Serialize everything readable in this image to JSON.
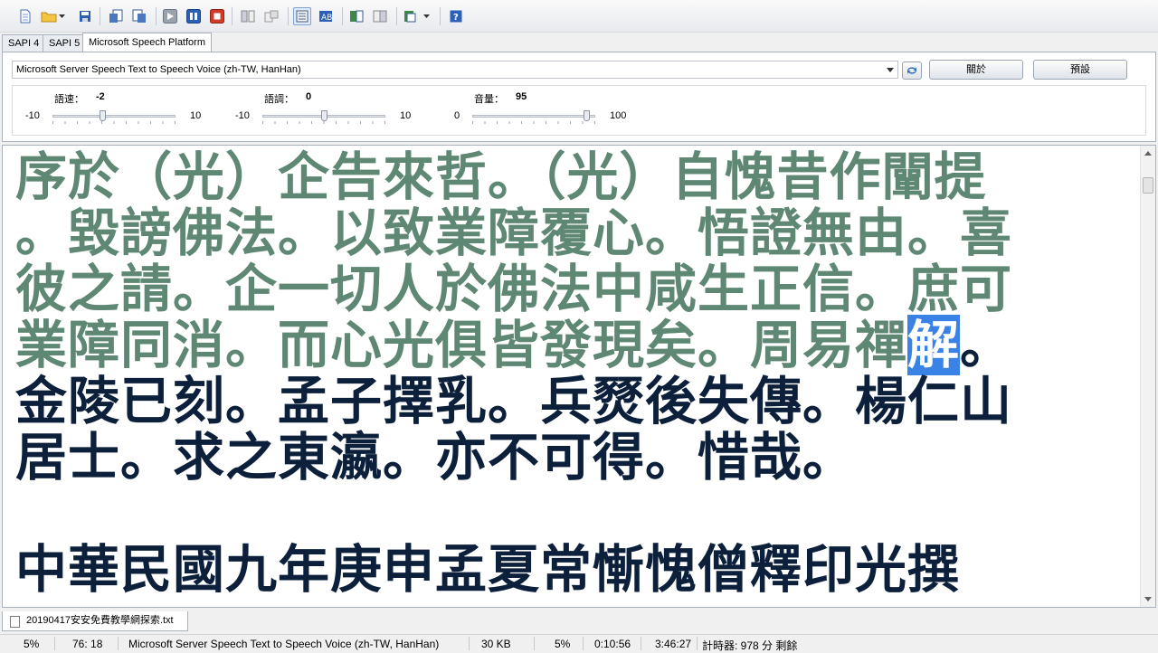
{
  "toolbar": {
    "icons": [
      "new-file",
      "open-folder",
      "save",
      "import-doc",
      "export-doc",
      "play",
      "pause",
      "stop",
      "split-view-a",
      "split-view-b",
      "text-view",
      "highlight-view",
      "convert-a",
      "convert-b",
      "dropdown-tool",
      "help"
    ]
  },
  "tabs": [
    {
      "label": "SAPI 4"
    },
    {
      "label": "SAPI 5"
    },
    {
      "label": "Microsoft Speech Platform"
    }
  ],
  "voice": {
    "selected": "Microsoft Server Speech Text to Speech Voice (zh-TW, HanHan)",
    "about_label": "關於",
    "default_label": "預設"
  },
  "sliders": {
    "rate": {
      "label": "語速：",
      "value": "-2",
      "min": "-10",
      "max": "10",
      "level": 0.4
    },
    "pitch": {
      "label": "語調：",
      "value": "0",
      "min": "-10",
      "max": "10",
      "level": 0.5
    },
    "volume": {
      "label": "音量：",
      "value": "95",
      "min": "0",
      "max": "100",
      "level": 0.95
    }
  },
  "editor": {
    "lines": [
      {
        "read": "序於（光）企告來哲。（光）自愧昔作闡提",
        "hl": "",
        "unread": ""
      },
      {
        "read": "。毀謗佛法。以致業障覆心。悟證無由。喜",
        "hl": "",
        "unread": ""
      },
      {
        "read": "彼之請。企一切人於佛法中咸生正信。庶可",
        "hl": "",
        "unread": ""
      },
      {
        "read": "業障同消。而心光俱皆發現矣。周易禪",
        "hl": "解",
        "unread": "。"
      },
      {
        "read": "",
        "hl": "",
        "unread": "金陵已刻。孟子擇乳。兵燹後失傳。楊仁山"
      },
      {
        "read": "",
        "hl": "",
        "unread": "居士。求之東瀛。亦不可得。惜哉。"
      },
      {
        "read": "",
        "hl": "",
        "unread": ""
      },
      {
        "read": "",
        "hl": "",
        "unread": "中華民國九年庚申孟夏常慚愧僧釋印光撰"
      }
    ],
    "colors": {
      "read": "#5f8874",
      "unread": "#0c1f3b",
      "highlight": "#3b82e6"
    }
  },
  "document_tab": {
    "filename": "20190417安安免費教學網探索.txt"
  },
  "status": {
    "zoom": "5%",
    "position": "76: 18",
    "voice": "Microsoft Server Speech Text to Speech Voice (zh-TW, HanHan)",
    "size": "30 KB",
    "progress": "5%",
    "elapsed": "0:10:56",
    "total": "3:46:27",
    "timer": "計時器: 978 分 剩餘"
  }
}
